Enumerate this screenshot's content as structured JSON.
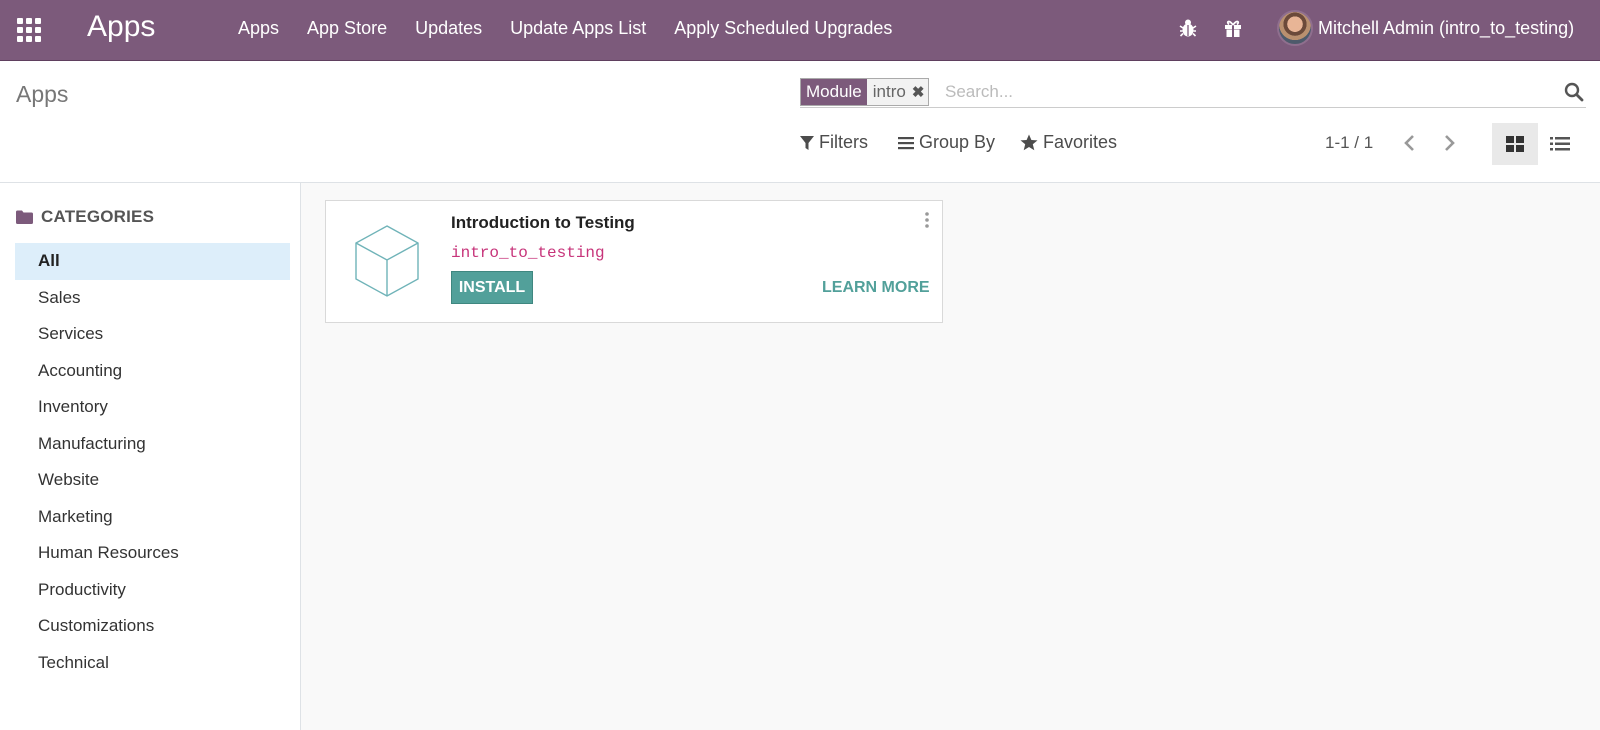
{
  "navbar": {
    "brand": "Apps",
    "menu_items": [
      "Apps",
      "App Store",
      "Updates",
      "Update Apps List",
      "Apply Scheduled Upgrades"
    ],
    "user": "Mitchell Admin (intro_to_testing)",
    "icons": [
      "apps-grid-icon",
      "bug-icon",
      "gift-icon"
    ]
  },
  "control_panel": {
    "breadcrumb": "Apps",
    "search": {
      "facet_label": "Module",
      "facet_value": "intro",
      "placeholder": "Search..."
    },
    "filters_label": "Filters",
    "group_by_label": "Group By",
    "favorites_label": "Favorites",
    "pager": "1-1 / 1"
  },
  "sidebar": {
    "header": "CATEGORIES",
    "items": [
      {
        "label": "All",
        "active": true
      },
      {
        "label": "Sales"
      },
      {
        "label": "Services"
      },
      {
        "label": "Accounting"
      },
      {
        "label": "Inventory"
      },
      {
        "label": "Manufacturing"
      },
      {
        "label": "Website"
      },
      {
        "label": "Marketing"
      },
      {
        "label": "Human Resources"
      },
      {
        "label": "Productivity"
      },
      {
        "label": "Customizations"
      },
      {
        "label": "Technical"
      }
    ]
  },
  "card": {
    "title": "Introduction to Testing",
    "technical_name": "intro_to_testing",
    "install_label": "INSTALL",
    "learn_more_label": "LEARN MORE"
  },
  "colors": {
    "navbar": "#7c5a7b",
    "primary": "#52a09a",
    "technical_name": "#c7347a",
    "active_category": "#ddeefa"
  }
}
